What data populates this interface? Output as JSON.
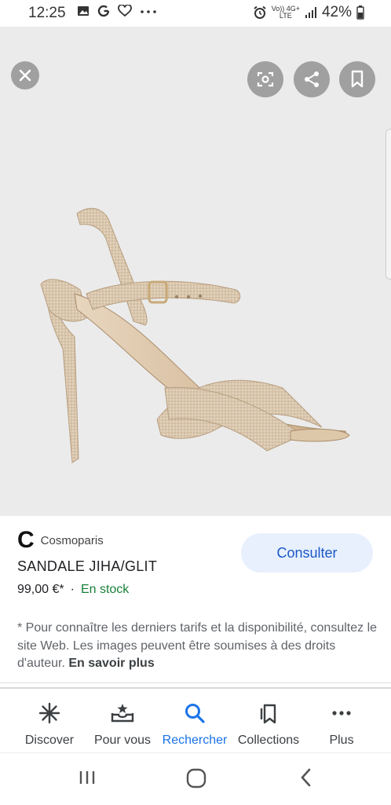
{
  "status_bar": {
    "time": "12:25",
    "icons": [
      "image-icon",
      "google-g-icon",
      "heart-icon",
      "more-dots-icon"
    ],
    "network_top": "Vo)) 4G+",
    "network_bottom": "LTE",
    "battery": "42%"
  },
  "hero": {
    "background": "#ebebeb",
    "product_image": "gold-glitter-high-heel-sandal"
  },
  "result": {
    "source": "Cosmoparis",
    "source_logo": "C",
    "title": "SANDALE JIHA/GLIT",
    "price": "99,00 €*",
    "separator": "·",
    "stock": "En stock",
    "action": "Consulter",
    "disclaimer": "* Pour connaître les derniers tarifs et la disponibilité, consultez le site Web. Les images peuvent être soumises à des droits d'auteur.",
    "more_link": "En savoir plus"
  },
  "bottom_nav": {
    "items": [
      {
        "label": "Discover",
        "icon": "asterisk-icon"
      },
      {
        "label": "Pour vous",
        "icon": "inbox-star-icon"
      },
      {
        "label": "Rechercher",
        "icon": "search-icon",
        "active": true
      },
      {
        "label": "Collections",
        "icon": "bookmarks-icon"
      },
      {
        "label": "Plus",
        "icon": "more-horizontal-icon"
      }
    ]
  },
  "colors": {
    "accent": "#1a73e8",
    "stock_green": "#188038",
    "button_bg": "#e8f0fe"
  }
}
